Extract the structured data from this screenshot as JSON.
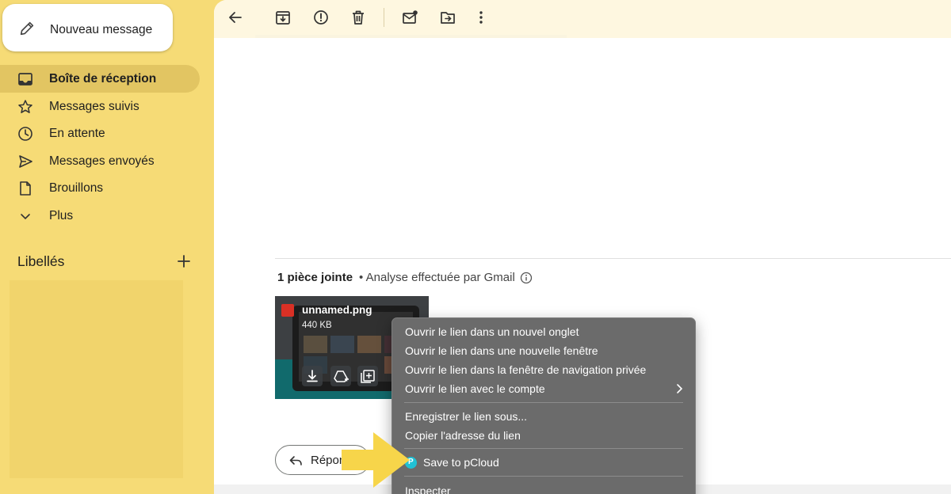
{
  "compose": {
    "label": "Nouveau message",
    "icon": "pencil-icon"
  },
  "sidebar": {
    "items": [
      {
        "label": "Boîte de réception",
        "icon": "inbox-icon",
        "active": true
      },
      {
        "label": "Messages suivis",
        "icon": "star-icon"
      },
      {
        "label": "En attente",
        "icon": "clock-icon"
      },
      {
        "label": "Messages envoyés",
        "icon": "send-icon"
      },
      {
        "label": "Brouillons",
        "icon": "draft-icon"
      },
      {
        "label": "Plus",
        "icon": "chevron-down-icon"
      }
    ],
    "labels_heading": "Libellés"
  },
  "toolbar": {
    "icons": [
      "back-arrow-icon",
      "archive-icon",
      "report-spam-icon",
      "delete-icon",
      "mark-unread-icon",
      "move-to-icon",
      "more-vert-icon"
    ]
  },
  "attachments": {
    "count_label": "1 pièce jointe",
    "scan_label": "• Analyse effectuée par Gmail",
    "file": {
      "name": "unnamed.png",
      "size": "440 KB"
    }
  },
  "reply": {
    "label": "Répondre"
  },
  "context_menu": {
    "items": [
      "Ouvrir le lien dans un nouvel onglet",
      "Ouvrir le lien dans une nouvelle fenêtre",
      "Ouvrir le lien dans la fenêtre de navigation privée",
      "Ouvrir le lien avec le compte",
      "Enregistrer le lien sous...",
      "Copier l'adresse du lien",
      "Save to pCloud",
      "Inspecter"
    ]
  },
  "colors": {
    "sidebar_bg": "#f6db76",
    "toolbar_bg": "#fef7e0",
    "menu_bg": "#6b6b6b",
    "arrow": "#f7d54a",
    "pcloud": "#20c1d5"
  }
}
